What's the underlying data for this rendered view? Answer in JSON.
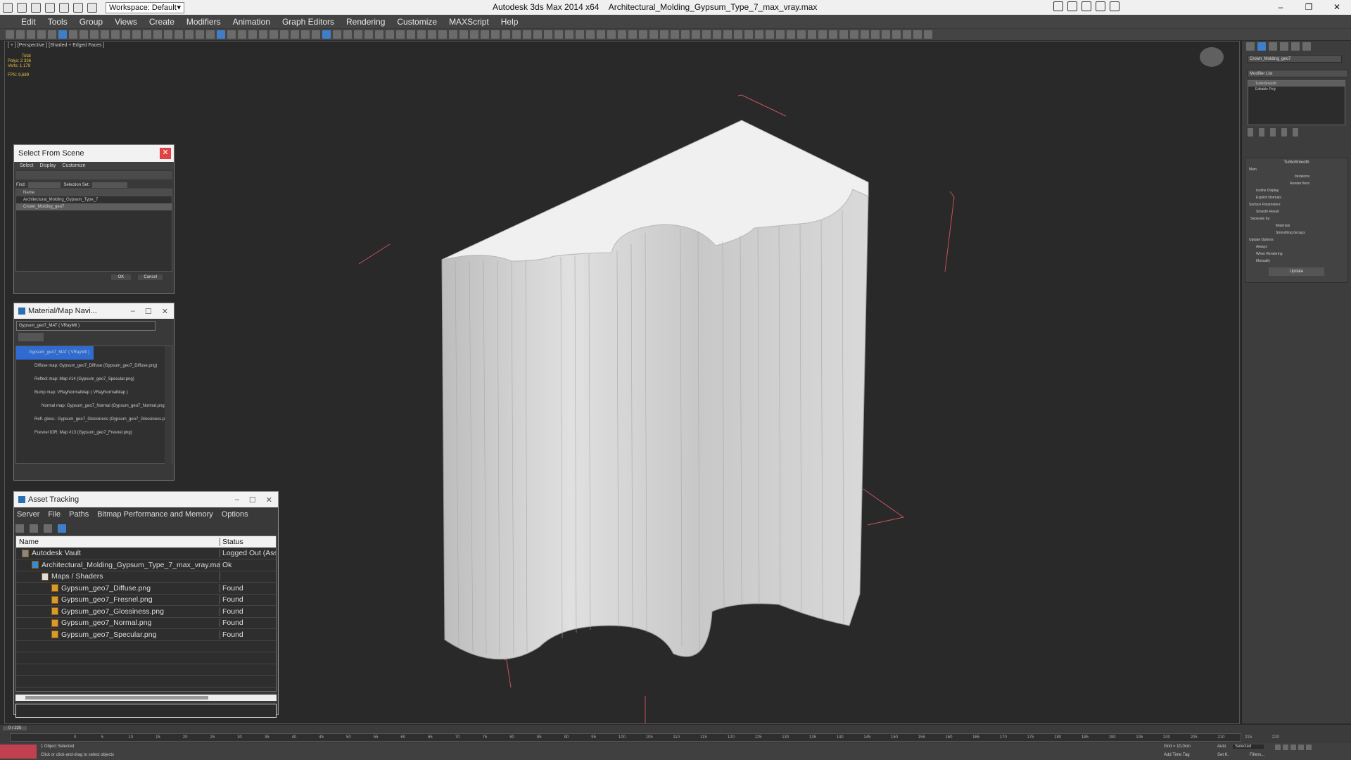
{
  "titlebar": {
    "workspace": "Workspace: Default",
    "app": "Autodesk 3ds Max  2014 x64",
    "file": "Architectural_Molding_Gypsum_Type_7_max_vray.max"
  },
  "menu": [
    "Edit",
    "Tools",
    "Group",
    "Views",
    "Create",
    "Modifiers",
    "Animation",
    "Graph Editors",
    "Rendering",
    "Customize",
    "MAXScript",
    "Help"
  ],
  "viewport": {
    "label": "[ + ] [Perspective ] [Shaded + Edged Faces ]",
    "stats": {
      "total": "Total",
      "polys_label": "Polys:",
      "polys": "2 336",
      "verts_label": "Verts:",
      "verts": "1 179",
      "fps_label": "FPS:",
      "fps": "9,689"
    }
  },
  "select_from_scene": {
    "title": "Select From Scene",
    "menu": [
      "Select",
      "Display",
      "Customize"
    ],
    "find_label": "Find:",
    "selection_set_label": "Selection Set:",
    "column": "Name",
    "items": [
      "Architectural_Molding_Gypsum_Type_7",
      "Crown_Molding_geo7"
    ],
    "ok": "OK",
    "cancel": "Cancel"
  },
  "material_navigator": {
    "title": "Material/Map Navi...",
    "search_value": "Gypsum_geo7_MAT  ( VRayMtl )",
    "items": [
      "Gypsum_geo7_MAT  ( VRayMtl )",
      "Diffuse map: Gypsum_geo7_Diffuse (Gypsum_geo7_Diffuse.png)",
      "Reflect map: Map #14 (Gypsum_geo7_Specular.png)",
      "Bump map: VRayNormalMap  ( VRayNormalMap )",
      "Normal map: Gypsum_geo7_Normal (Gypsum_geo7_Normal.png)",
      "Refl. gloss.: Gypsum_geo7_Glossiness (Gypsum_geo7_Glossiness.png)",
      "Fresnel IOR: Map #13 (Gypsum_geo7_Fresnel.png)"
    ]
  },
  "asset_tracking": {
    "title": "Asset Tracking",
    "menu": [
      "Server",
      "File",
      "Paths",
      "Bitmap Performance and Memory",
      "Options"
    ],
    "col_name": "Name",
    "col_status": "Status",
    "rows": [
      {
        "name": "Autodesk Vault",
        "status": "Logged Out (Asset"
      },
      {
        "name": "Architectural_Molding_Gypsum_Type_7_max_vray.max",
        "status": "Ok"
      },
      {
        "name": "Maps / Shaders",
        "status": ""
      },
      {
        "name": "Gypsum_geo7_Diffuse.png",
        "status": "Found"
      },
      {
        "name": "Gypsum_geo7_Fresnel.png",
        "status": "Found"
      },
      {
        "name": "Gypsum_geo7_Glossiness.png",
        "status": "Found"
      },
      {
        "name": "Gypsum_geo7_Normal.png",
        "status": "Found"
      },
      {
        "name": "Gypsum_geo7_Specular.png",
        "status": "Found"
      }
    ]
  },
  "command_panel": {
    "object_name": "Crown_Molding_geo7",
    "modifier_list": "Modifier List",
    "stack": [
      "TurboSmooth",
      "Editable Poly"
    ],
    "turbosmooth": {
      "title": "TurboSmooth",
      "main": "Main",
      "iterations": "Iterations:",
      "render_iters": "Render Iters:",
      "isoline": "Isoline Display",
      "explicit": "Explicit Normals",
      "surface": "Surface Parameters",
      "smooth_result": "Smooth Result",
      "separate": "Separate by:",
      "materials": "Materials",
      "smoothing": "Smoothing Groups",
      "update_options": "Update Options",
      "always": "Always",
      "when_rendering": "When Rendering",
      "manually": "Manually",
      "update": "Update"
    }
  },
  "timeline": {
    "frame": "0 / 225",
    "ticks": [
      "0",
      "5",
      "10",
      "15",
      "20",
      "25",
      "30",
      "35",
      "40",
      "45",
      "50",
      "55",
      "60",
      "65",
      "70",
      "75",
      "80",
      "85",
      "90",
      "95",
      "100",
      "105",
      "110",
      "115",
      "120",
      "125",
      "130",
      "135",
      "140",
      "145",
      "150",
      "155",
      "160",
      "165",
      "170",
      "175",
      "180",
      "185",
      "190",
      "195",
      "200",
      "205",
      "210",
      "215",
      "220"
    ]
  },
  "status": {
    "selected": "1 Object Selected",
    "prompt": "Click or click-and-drag to select objects",
    "grid": "Grid = 10,0cm",
    "auto": "Auto",
    "selected_dd": "Selected",
    "setk": "Set K.",
    "filters": "Filters...",
    "add_time_tag": "Add Time Tag"
  }
}
